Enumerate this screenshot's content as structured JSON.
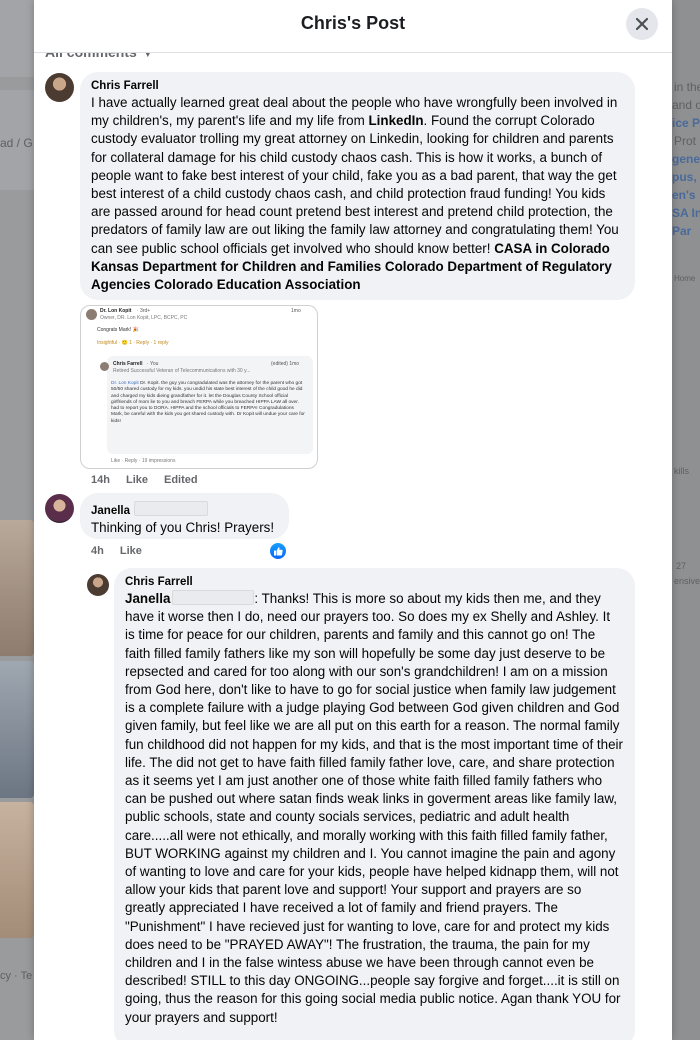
{
  "modal": {
    "title": "Chris's Post",
    "sort_label": "All comments"
  },
  "comments": [
    {
      "author": "Chris Farrell",
      "text_parts": [
        "I have actually learned great deal about the people who have wrongfully been involved in my children's, my parent's life and my life from ",
        "LinkedIn",
        ". Found the corrupt Colorado custody evaluator trolling my great attorney on Linkedin, looking for children and parents for collateral damage for his child custody chaos cash. This is how it works, a bunch of people want to fake best interest of your child, fake you as a bad parent, that way the get best interest of a child custody chaos cash, and child protection fraud funding! You kids are passed around for head count pretend best interest and pretend child protection, the predators of family law are out liking the family law attorney and congratulating them! You can see public school officials get involved who should know better! ",
        "CASA in Colorado Kansas Department for Children and Families Colorado Department of Regulatory Agencies Colorado Education Association"
      ],
      "time": "14h",
      "like": "Like",
      "edited": "Edited"
    },
    {
      "author": "Janella",
      "text": "Thinking of you Chris! Prayers!",
      "time": "4h",
      "like": "Like"
    },
    {
      "author": "Chris Farrell",
      "mention": "Janella",
      "text": ": Thanks! This is more so about my kids then me, and they have it worse then I do, need our prayers too. So does my ex Shelly and Ashley. It is time for peace for our children, parents and family and this cannot go on! The faith filled family fathers like my son will hopefully be some day just deserve to be repsected and cared for too along with our son's grandchildren! I am on a mission from God here, don't like to have to go for social justice when family law judgement is a complete failure with a judge playing God between God given children and God given family, but feel like we are all put on this earth for a reason. The normal family fun childhood did not happen for my kids, and that is the most important time of their life. The did not get to have faith filled family father love, care, and share protection as it seems yet I am just another one of those white faith filled family fathers who can be pushed out where satan finds weak links in goverment areas like family law, public schools, state and county socials services, pediatric and adult health care.....all were not ethically, and morally working with this faith filled family father, BUT WORKING against my children and I. You cannot imagine the pain and agony of wanting to love and care for your kids, people have helped kidnapp them, will not allow your kids that parent love and support! Your support and prayers are so greatly appreciated I have received a lot of family and friend prayers. The \"Punishment\" I have recieved just for wanting to love, care for and protect my kids does need to be \"PRAYED AWAY\"! The frustration, the trauma, the pain for my children and I in the false wintess abuse we have been through cannot even be described! STILL to this day ONGOING...people say forgive and forget....it is still on going, thus the reason for this going social media public notice. Agan thank YOU for your prayers and support!"
    }
  ],
  "attachment": {
    "name": "Dr. Lon Kopit",
    "degree": "· 3rd+",
    "subtitle": "Owner, DR. Lon Kopit, LPC, BCPC, PC",
    "time": "1mo",
    "congrats": "Congrats Mark! 🎉",
    "reaction": "Insightful · 🙂 1 · Reply · 1 reply",
    "reply_author": "Chris Farrell",
    "reply_you": "· You",
    "reply_edited": "(edited) 1mo",
    "reply_sub": "Retired Successful Veteran of Telecommunications with 30 y...",
    "reply_name": "Dr. Lon Kopit",
    "reply_text": "Dr. Kopit. the guy you congradulated was the attorney for the parent who got 50/50 shared custody for my kids. you undid his state best interest of the child good he did and charged my kids dieing grandfather for it. let the Douglas County School official girlfriends of mom lie to you and breach FERPA while you breached HIPPA LAW all over. had to report you to DORA. HIPPA and the school officials to FERPA! Congradulations Mark, be careful with the kids you get shared custody with. Dr Kopit will undue your care for kids!",
    "footer": "Like · Reply · 19 impressions"
  },
  "background": {
    "left_text": "ad / G",
    "right_lines": [
      "in the",
      "and o",
      "ice P",
      "Prot",
      "gene",
      "pus,",
      "en's",
      "SA In",
      " Par"
    ],
    "right_small_1": "Home",
    "right_small_2": "kills",
    "right_small_3": "27",
    "right_small_4": "ensive",
    "footer_left": "cy · Te"
  }
}
